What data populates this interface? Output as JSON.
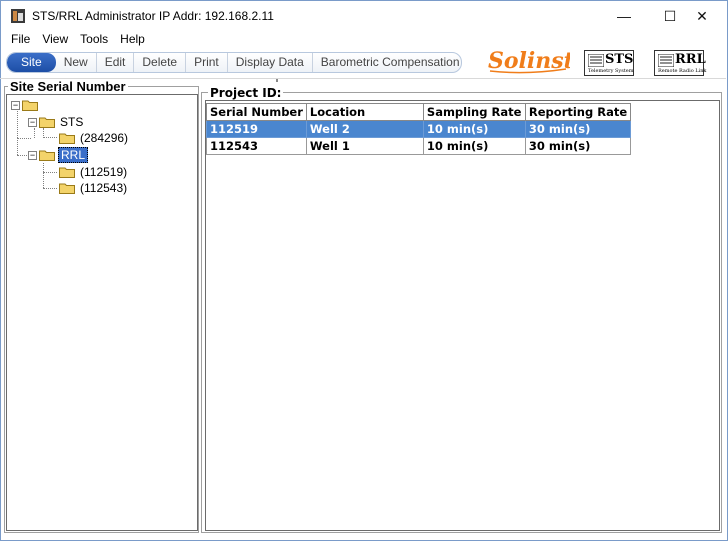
{
  "window": {
    "title": "STS/RRL Administrator IP Addr: 192.168.2.11",
    "controls": {
      "minimize": "—",
      "maximize": "☐",
      "close": "✕"
    }
  },
  "menu": [
    {
      "label": "File"
    },
    {
      "label": "View"
    },
    {
      "label": "Tools"
    },
    {
      "label": "Help"
    }
  ],
  "toolbar": {
    "buttons": [
      {
        "label": "Site",
        "active": true
      },
      {
        "label": "New"
      },
      {
        "label": "Edit"
      },
      {
        "label": "Delete"
      },
      {
        "label": "Print"
      },
      {
        "label": "Display Data"
      },
      {
        "label": "Barometric Compensation"
      }
    ]
  },
  "logos": {
    "solinst": "Solinst",
    "sts": {
      "main": "STS",
      "sub": "Telemetry System"
    },
    "rrl": {
      "main": "RRL",
      "sub": "Remote Radio Link"
    }
  },
  "left_panel": {
    "title": "Site Serial Number",
    "tree": {
      "root": {
        "label": "",
        "expander": "−"
      },
      "sts": {
        "label": "STS",
        "expander": "−"
      },
      "sts_child": {
        "label": "(284296)"
      },
      "rrl": {
        "label": "RRL",
        "expander": "−",
        "selected": true
      },
      "rrl_child_1": {
        "label": "(112519)"
      },
      "rrl_child_2": {
        "label": "(112543)"
      }
    }
  },
  "right_panel": {
    "title": "Project ID:",
    "table": {
      "columns": [
        "Serial Number",
        "Location",
        "Sampling Rate",
        "Reporting Rate"
      ],
      "rows": [
        {
          "cells": [
            "112519",
            "Well 2",
            "10 min(s)",
            "30 min(s)"
          ],
          "selected": true
        },
        {
          "cells": [
            "112543",
            "Well 1",
            "10 min(s)",
            "30 min(s)"
          ],
          "selected": false
        }
      ]
    }
  },
  "colors": {
    "selection": "#4a86cf",
    "site_button": "#1d4ea6",
    "solinst_orange": "#f07d1a",
    "folder_yellow": "#f3d36a"
  }
}
